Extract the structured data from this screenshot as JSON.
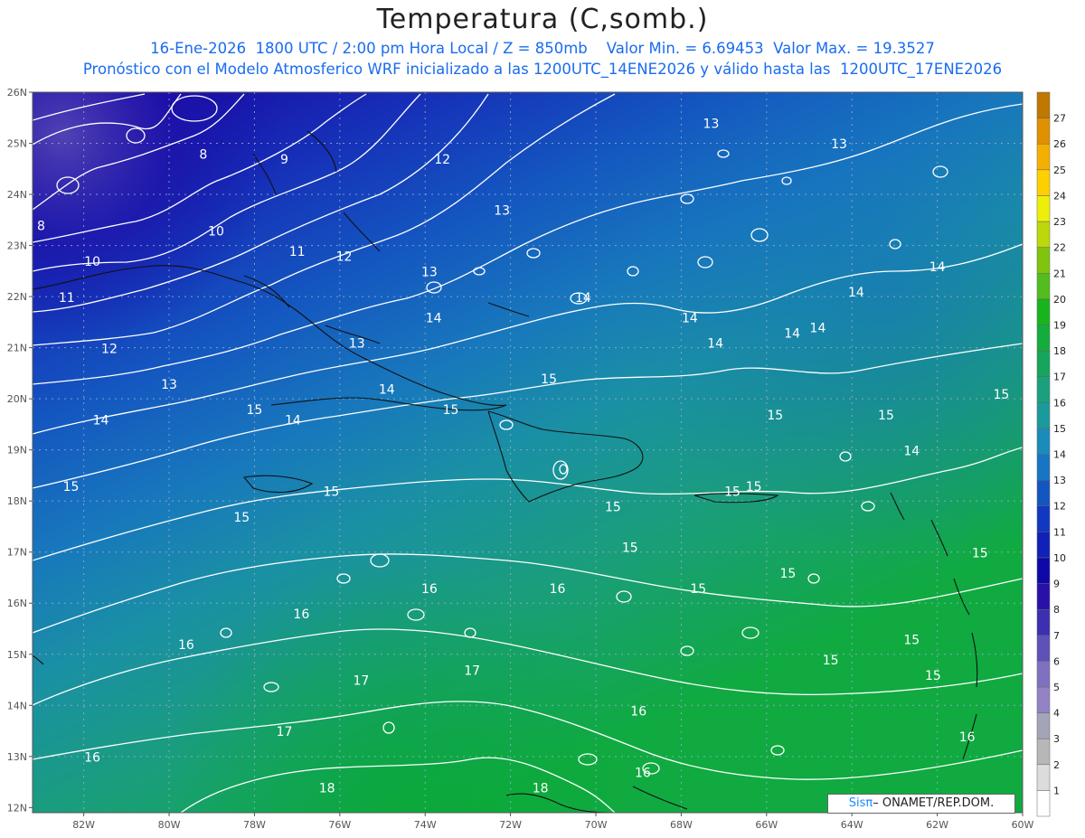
{
  "header": {
    "title": "Temperatura (C,somb.)",
    "line1": "16-Ene-2026  1800 UTC / 2:00 pm Hora Local / Z = 850mb    Valor Min. = 6.69453  Valor Max. = 19.3527",
    "line2": "Pronóstico con el Modelo Atmosferico WRF inicializado a las 1200UTC_14ENE2026 y válido hasta las  1200UTC_17ENE2026"
  },
  "map": {
    "lat_labels": [
      "26N",
      "25N",
      "24N",
      "23N",
      "22N",
      "21N",
      "20N",
      "19N",
      "18N",
      "17N",
      "16N",
      "15N",
      "14N",
      "13N",
      "12N"
    ],
    "lon_labels": [
      "82W",
      "80W",
      "78W",
      "76W",
      "74W",
      "72W",
      "70W",
      "68W",
      "66W",
      "64W",
      "62W",
      "60W"
    ],
    "contour_labels": [
      {
        "text": "8",
        "lon": -79.2,
        "lat": 24.7
      },
      {
        "text": "9",
        "lon": -77.3,
        "lat": 24.6
      },
      {
        "text": "8",
        "lon": -83.0,
        "lat": 23.3
      },
      {
        "text": "10",
        "lon": -78.9,
        "lat": 23.2
      },
      {
        "text": "10",
        "lon": -81.8,
        "lat": 22.6
      },
      {
        "text": "11",
        "lon": -77.0,
        "lat": 22.8
      },
      {
        "text": "12",
        "lon": -75.9,
        "lat": 22.7
      },
      {
        "text": "11",
        "lon": -82.4,
        "lat": 21.9
      },
      {
        "text": "12",
        "lon": -81.4,
        "lat": 20.9
      },
      {
        "text": "13",
        "lon": -80.0,
        "lat": 20.2
      },
      {
        "text": "14",
        "lon": -81.6,
        "lat": 19.5
      },
      {
        "text": "12",
        "lon": -73.6,
        "lat": 24.6
      },
      {
        "text": "13",
        "lon": -72.2,
        "lat": 23.6
      },
      {
        "text": "13",
        "lon": -73.9,
        "lat": 22.4
      },
      {
        "text": "14",
        "lon": -70.3,
        "lat": 21.9
      },
      {
        "text": "14",
        "lon": -73.8,
        "lat": 21.5
      },
      {
        "text": "13",
        "lon": -75.6,
        "lat": 21.0
      },
      {
        "text": "14",
        "lon": -74.9,
        "lat": 20.1
      },
      {
        "text": "14",
        "lon": -77.1,
        "lat": 19.5
      },
      {
        "text": "15",
        "lon": -78.0,
        "lat": 19.7
      },
      {
        "text": "15",
        "lon": -73.4,
        "lat": 19.7
      },
      {
        "text": "15",
        "lon": -71.1,
        "lat": 20.3
      },
      {
        "text": "13",
        "lon": -67.3,
        "lat": 25.3
      },
      {
        "text": "13",
        "lon": -64.3,
        "lat": 24.9
      },
      {
        "text": "14",
        "lon": -67.8,
        "lat": 21.5
      },
      {
        "text": "14",
        "lon": -67.2,
        "lat": 21.0
      },
      {
        "text": "14",
        "lon": -65.4,
        "lat": 21.2
      },
      {
        "text": "14",
        "lon": -64.8,
        "lat": 21.3
      },
      {
        "text": "14",
        "lon": -63.9,
        "lat": 22.0
      },
      {
        "text": "14",
        "lon": -62.0,
        "lat": 22.5
      },
      {
        "text": "15",
        "lon": -60.5,
        "lat": 20.0
      },
      {
        "text": "15",
        "lon": -65.8,
        "lat": 19.6
      },
      {
        "text": "15",
        "lon": -63.2,
        "lat": 19.6
      },
      {
        "text": "14",
        "lon": -62.6,
        "lat": 18.9
      },
      {
        "text": "15",
        "lon": -82.3,
        "lat": 18.2
      },
      {
        "text": "15",
        "lon": -76.2,
        "lat": 18.1
      },
      {
        "text": "15",
        "lon": -78.3,
        "lat": 17.6
      },
      {
        "text": "15",
        "lon": -69.6,
        "lat": 17.8
      },
      {
        "text": "15",
        "lon": -66.8,
        "lat": 18.1
      },
      {
        "text": "15",
        "lon": -66.3,
        "lat": 18.2
      },
      {
        "text": "15",
        "lon": -69.2,
        "lat": 17.0
      },
      {
        "text": "15",
        "lon": -61.0,
        "lat": 16.9
      },
      {
        "text": "15",
        "lon": -65.5,
        "lat": 16.5
      },
      {
        "text": "15",
        "lon": -67.6,
        "lat": 16.2
      },
      {
        "text": "16",
        "lon": -73.9,
        "lat": 16.2
      },
      {
        "text": "16",
        "lon": -70.9,
        "lat": 16.2
      },
      {
        "text": "16",
        "lon": -76.9,
        "lat": 15.7
      },
      {
        "text": "16",
        "lon": -79.6,
        "lat": 15.1
      },
      {
        "text": "15",
        "lon": -62.6,
        "lat": 15.2
      },
      {
        "text": "15",
        "lon": -64.5,
        "lat": 14.8
      },
      {
        "text": "15",
        "lon": -62.1,
        "lat": 14.5
      },
      {
        "text": "17",
        "lon": -72.9,
        "lat": 14.6
      },
      {
        "text": "17",
        "lon": -75.5,
        "lat": 14.4
      },
      {
        "text": "16",
        "lon": -69.0,
        "lat": 13.8
      },
      {
        "text": "17",
        "lon": -77.3,
        "lat": 13.4
      },
      {
        "text": "16",
        "lon": -61.3,
        "lat": 13.3
      },
      {
        "text": "16",
        "lon": -81.8,
        "lat": 12.9
      },
      {
        "text": "16",
        "lon": -68.9,
        "lat": 12.6
      },
      {
        "text": "18",
        "lon": -76.3,
        "lat": 12.3
      },
      {
        "text": "18",
        "lon": -71.3,
        "lat": 12.3
      }
    ]
  },
  "colorbar": {
    "levels": [
      "1",
      "2",
      "3",
      "4",
      "5",
      "6",
      "7",
      "8",
      "9",
      "10",
      "11",
      "12",
      "13",
      "14",
      "15",
      "16",
      "17",
      "18",
      "19",
      "20",
      "21",
      "22",
      "23",
      "24",
      "25",
      "26",
      "27"
    ],
    "colors": [
      "#ffffff",
      "#dcdcdc",
      "#b7b7b7",
      "#a4a4b8",
      "#9383c4",
      "#8070c0",
      "#5e51b8",
      "#3c2fb0",
      "#2810a8",
      "#0e08a8",
      "#1020b8",
      "#1038c0",
      "#1456c0",
      "#1676c4",
      "#1a8cbc",
      "#1b9a9e",
      "#1aa07c",
      "#16a55c",
      "#14ad3c",
      "#18b41e",
      "#52bd1c",
      "#80c40e",
      "#bcd80a",
      "#eeef08",
      "#ffd000",
      "#f4b000",
      "#e09000",
      "#c07800"
    ]
  },
  "credit": {
    "brand": "Sisπ",
    "text": "– ONAMET/REP.DOM."
  }
}
